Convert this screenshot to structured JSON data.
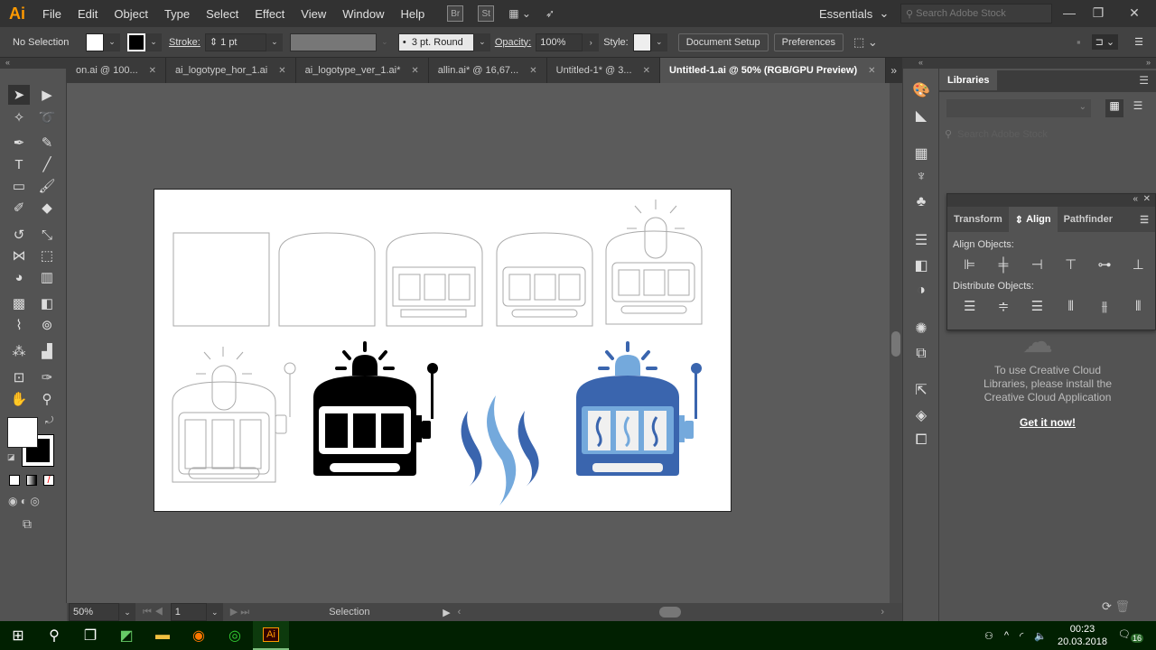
{
  "app": {
    "logo": "Ai",
    "menu": [
      "File",
      "Edit",
      "Object",
      "Type",
      "Select",
      "Effect",
      "View",
      "Window",
      "Help"
    ],
    "bridge": "Br",
    "stock": "St",
    "workspace": "Essentials",
    "search_placeholder": "Search Adobe Stock"
  },
  "control": {
    "selection": "No Selection",
    "stroke_label": "Stroke:",
    "stroke_value": "1 pt",
    "brush": "3 pt. Round",
    "opacity_label": "Opacity:",
    "opacity_value": "100%",
    "style_label": "Style:",
    "document_setup": "Document Setup",
    "preferences": "Preferences"
  },
  "tabs": [
    {
      "label": "on.ai @ 100..."
    },
    {
      "label": "ai_logotype_hor_1.ai"
    },
    {
      "label": "ai_logotype_ver_1.ai*"
    },
    {
      "label": "allin.ai* @ 16,67..."
    },
    {
      "label": "Untitled-1* @ 3..."
    },
    {
      "label": "Untitled-1.ai @ 50% (RGB/GPU Preview)",
      "active": true
    }
  ],
  "status": {
    "zoom": "50%",
    "artboard": "1",
    "tool": "Selection"
  },
  "libraries": {
    "title": "Libraries",
    "search_placeholder": "Search Adobe Stock",
    "message": "To use Creative Cloud Libraries, please install the Creative Cloud Application",
    "link": "Get it now!"
  },
  "align_panel": {
    "tabs": [
      "Transform",
      "Align",
      "Pathfinder"
    ],
    "active_tab": "Align",
    "align_objects": "Align Objects:",
    "distribute_objects": "Distribute Objects:"
  },
  "artwork_colors": {
    "dark_blue": "#3a65ae",
    "light_blue": "#74a9dc",
    "black": "#000000",
    "outline": "#aaaaaa"
  },
  "taskbar": {
    "time": "00:23",
    "date": "20.03.2018",
    "notifications": "16"
  }
}
